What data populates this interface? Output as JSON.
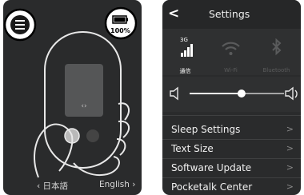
{
  "left_screen": {
    "lang_source": "日本語",
    "lang_target": "English"
  },
  "settings": {
    "title": "Settings",
    "battery_percent": "100%",
    "status": {
      "network_type": "3G",
      "cellular_label": "通信",
      "wifi_label": "Wi-Fi",
      "bluetooth_label": "Bluetooth"
    },
    "volume_level": 0.55,
    "menu": [
      {
        "label": "Sleep Settings"
      },
      {
        "label": "Text Size"
      },
      {
        "label": "Software Update"
      },
      {
        "label": "Pocketalk Center"
      }
    ]
  },
  "colors": {
    "screen_bg": "#2a2b2c",
    "row_text": "#f0f0f0",
    "disabled": "#5a5b5c"
  }
}
